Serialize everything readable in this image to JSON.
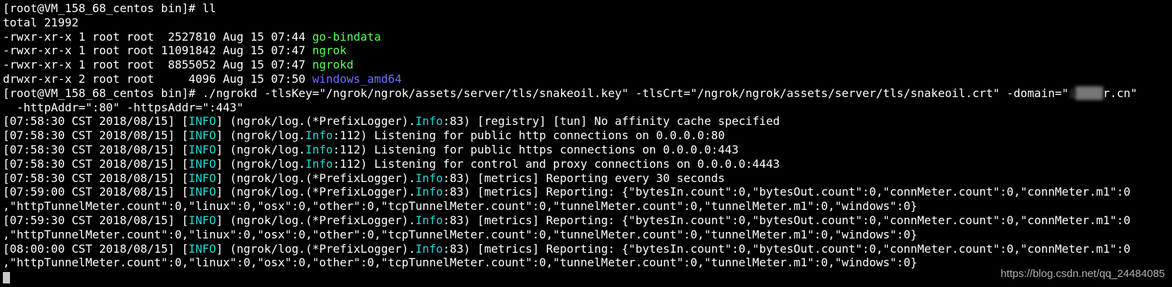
{
  "terminal": {
    "lines": [
      [
        {
          "t": "[root@VM_158_68_centos bin]# ll",
          "c": "plain"
        }
      ],
      [
        {
          "t": "total 21992",
          "c": "plain"
        }
      ],
      [
        {
          "t": "-rwxr-xr-x 1 root root  2527810 Aug 15 07:44 ",
          "c": "plain"
        },
        {
          "t": "go-bindata",
          "c": "green"
        }
      ],
      [
        {
          "t": "-rwxr-xr-x 1 root root 11091842 Aug 15 07:47 ",
          "c": "plain"
        },
        {
          "t": "ngrok",
          "c": "green"
        }
      ],
      [
        {
          "t": "-rwxr-xr-x 1 root root  8855052 Aug 15 07:47 ",
          "c": "plain"
        },
        {
          "t": "ngrokd",
          "c": "green"
        }
      ],
      [
        {
          "t": "drwxr-xr-x 2 root root     4096 Aug 15 07:50 ",
          "c": "plain"
        },
        {
          "t": "windows_amd64",
          "c": "blue"
        }
      ],
      [
        {
          "t": "[root@VM_158_68_centos bin]# ./ngrokd -tlsKey=\"/ngrok/ngrok/assets/server/tls/snakeoil.key\" -tlsCrt=\"/ngrok/ngrok/assets/server/tls/snakeoil.crt\" -domain=\"",
          "c": "plain"
        },
        {
          "t": "i████",
          "c": "blurred"
        },
        {
          "t": "r.cn\"",
          "c": "plain"
        }
      ],
      [
        {
          "t": "  -httpAddr=\":80\" -httpsAddr=\":443\"",
          "c": "plain"
        }
      ],
      [
        {
          "t": "[07:58:30 CST 2018/08/15] [",
          "c": "plain"
        },
        {
          "t": "INFO",
          "c": "cyan"
        },
        {
          "t": "] (ngrok/log.(*PrefixLogger).",
          "c": "plain"
        },
        {
          "t": "Info",
          "c": "cyan"
        },
        {
          "t": ":83) [registry] [tun] No affinity cache specified",
          "c": "plain"
        }
      ],
      [
        {
          "t": "[07:58:30 CST 2018/08/15] [",
          "c": "plain"
        },
        {
          "t": "INFO",
          "c": "cyan"
        },
        {
          "t": "] (ngrok/log.",
          "c": "plain"
        },
        {
          "t": "Info",
          "c": "cyan"
        },
        {
          "t": ":112) Listening for public http connections on 0.0.0.0:80",
          "c": "plain"
        }
      ],
      [
        {
          "t": "[07:58:30 CST 2018/08/15] [",
          "c": "plain"
        },
        {
          "t": "INFO",
          "c": "cyan"
        },
        {
          "t": "] (ngrok/log.",
          "c": "plain"
        },
        {
          "t": "Info",
          "c": "cyan"
        },
        {
          "t": ":112) Listening for public https connections on 0.0.0.0:443",
          "c": "plain"
        }
      ],
      [
        {
          "t": "[07:58:30 CST 2018/08/15] [",
          "c": "plain"
        },
        {
          "t": "INFO",
          "c": "cyan"
        },
        {
          "t": "] (ngrok/log.",
          "c": "plain"
        },
        {
          "t": "Info",
          "c": "cyan"
        },
        {
          "t": ":112) Listening for control and proxy connections on 0.0.0.0:4443",
          "c": "plain"
        }
      ],
      [
        {
          "t": "[07:58:30 CST 2018/08/15] [",
          "c": "plain"
        },
        {
          "t": "INFO",
          "c": "cyan"
        },
        {
          "t": "] (ngrok/log.(*PrefixLogger).",
          "c": "plain"
        },
        {
          "t": "Info",
          "c": "cyan"
        },
        {
          "t": ":83) [metrics] Reporting every 30 seconds",
          "c": "plain"
        }
      ],
      [
        {
          "t": "[07:59:00 CST 2018/08/15] [",
          "c": "plain"
        },
        {
          "t": "INFO",
          "c": "cyan"
        },
        {
          "t": "] (ngrok/log.(*PrefixLogger).",
          "c": "plain"
        },
        {
          "t": "Info",
          "c": "cyan"
        },
        {
          "t": ":83) [metrics] Reporting: {\"bytesIn.count\":0,\"bytesOut.count\":0,\"connMeter.count\":0,\"connMeter.m1\":0",
          "c": "plain"
        }
      ],
      [
        {
          "t": ",\"httpTunnelMeter.count\":0,\"linux\":0,\"osx\":0,\"other\":0,\"tcpTunnelMeter.count\":0,\"tunnelMeter.count\":0,\"tunnelMeter.m1\":0,\"windows\":0}",
          "c": "plain"
        }
      ],
      [
        {
          "t": "[07:59:30 CST 2018/08/15] [",
          "c": "plain"
        },
        {
          "t": "INFO",
          "c": "cyan"
        },
        {
          "t": "] (ngrok/log.(*PrefixLogger).",
          "c": "plain"
        },
        {
          "t": "Info",
          "c": "cyan"
        },
        {
          "t": ":83) [metrics] Reporting: {\"bytesIn.count\":0,\"bytesOut.count\":0,\"connMeter.count\":0,\"connMeter.m1\":0",
          "c": "plain"
        }
      ],
      [
        {
          "t": ",\"httpTunnelMeter.count\":0,\"linux\":0,\"osx\":0,\"other\":0,\"tcpTunnelMeter.count\":0,\"tunnelMeter.count\":0,\"tunnelMeter.m1\":0,\"windows\":0}",
          "c": "plain"
        }
      ],
      [
        {
          "t": "[08:00:00 CST 2018/08/15] [",
          "c": "plain"
        },
        {
          "t": "INFO",
          "c": "cyan"
        },
        {
          "t": "] (ngrok/log.(*PrefixLogger).",
          "c": "plain"
        },
        {
          "t": "Info",
          "c": "cyan"
        },
        {
          "t": ":83) [metrics] Reporting: {\"bytesIn.count\":0,\"bytesOut.count\":0,\"connMeter.count\":0,\"connMeter.m1\":0",
          "c": "plain"
        }
      ],
      [
        {
          "t": ",\"httpTunnelMeter.count\":0,\"linux\":0,\"osx\":0,\"other\":0,\"tcpTunnelMeter.count\":0,\"tunnelMeter.count\":0,\"tunnelMeter.m1\":0,\"windows\":0}",
          "c": "plain"
        }
      ]
    ]
  },
  "watermark": "https://blog.csdn.net/qq_24484085",
  "colors": {
    "background": "#000000",
    "text": "#ffffff",
    "executable": "#55ff55",
    "directory": "#6f6fff",
    "info": "#22d6d6"
  }
}
